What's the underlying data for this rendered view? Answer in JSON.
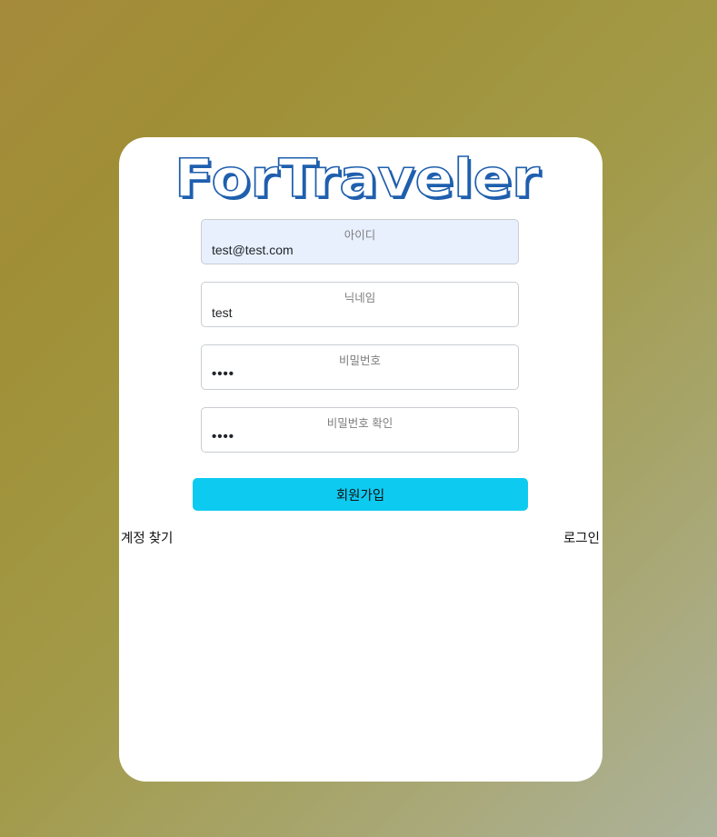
{
  "brand": {
    "logo_text": "ForTraveler",
    "colors": {
      "logo_stroke": "#1f5fae",
      "logo_fill": "#ffffff",
      "accent": "#0dcaf0",
      "autofill_bg": "#e8f0fe"
    }
  },
  "form": {
    "fields": [
      {
        "label": "아이디",
        "value": "test@test.com"
      },
      {
        "label": "닉네임",
        "value": "test"
      },
      {
        "label": "비밀번호",
        "value": "••••"
      },
      {
        "label": "비밀번호 확인",
        "value": "••••"
      }
    ],
    "submit_label": "회원가입"
  },
  "links": {
    "find_account": "계정 찾기",
    "login": "로그인"
  }
}
